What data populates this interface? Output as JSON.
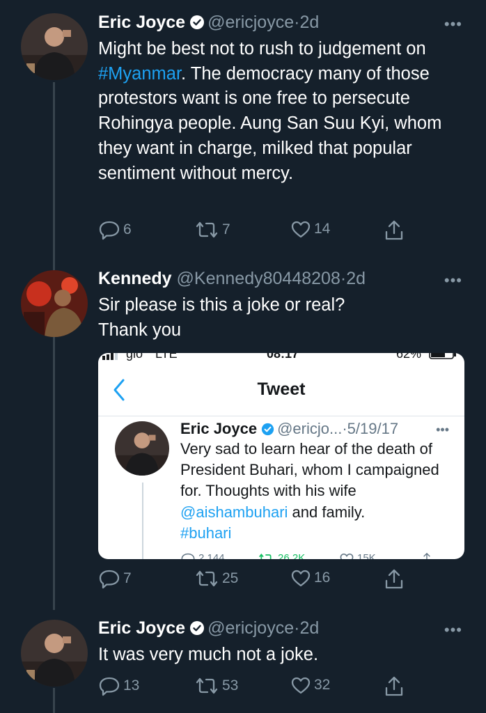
{
  "tweets": [
    {
      "name": "Eric Joyce",
      "handle": "@ericjoyce",
      "sep": "·",
      "time": "2d",
      "more": "•••",
      "verified": true,
      "text_parts": [
        "Might be best not to rush to judgement on ",
        "#Myanmar",
        ". The democracy many of those protestors want is one free to persecute Rohingya people. Aung San Suu Kyi, whom they want in charge, milked that popular sentiment without mercy."
      ],
      "replies": "6",
      "retweets": "7",
      "likes": "14"
    },
    {
      "name": "Kennedy",
      "handle": "@Kennedy80448208",
      "sep": "·",
      "time": "2d",
      "more": "•••",
      "verified": false,
      "text": "Sir please is this a joke or real? Thank you",
      "replies": "7",
      "retweets": "25",
      "likes": "16"
    },
    {
      "name": "Eric Joyce",
      "handle": "@ericjoyce",
      "sep": "·",
      "time": "2d",
      "more": "•••",
      "verified": true,
      "text": "It was very much not a joke.",
      "replies": "13",
      "retweets": "53",
      "likes": "32"
    }
  ],
  "embedded": {
    "status_bar": {
      "carrier": "glo",
      "network": "LTE",
      "clock": "08:17",
      "battery": "62%"
    },
    "header_title": "Tweet",
    "tweet": {
      "name": "Eric Joyce",
      "handle": "@ericjo...",
      "sep": "·",
      "time": "5/19/17",
      "more": "•••",
      "text_1": "Very sad to learn hear of the death of President Buhari, whom I campaigned for. Thoughts with his wife ",
      "mention": "@aishambuhari",
      "text_2": " and family.",
      "hashtag": "#buhari",
      "replies": "2,144",
      "retweets": "26.2K",
      "likes": "15K"
    }
  },
  "icons": {
    "reply": "reply-icon",
    "retweet": "retweet-icon",
    "like": "heart-icon",
    "share": "share-icon",
    "verified": "verified-badge-icon",
    "back": "chevron-left-icon",
    "more": "more-icon"
  },
  "colors": {
    "background": "#15202b",
    "link": "#1da1f2",
    "muted": "#8899a6",
    "divider": "#38444d"
  }
}
